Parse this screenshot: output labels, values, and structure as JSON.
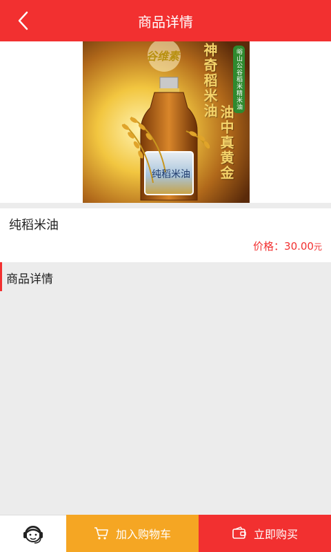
{
  "header": {
    "title": "商品详情",
    "back_icon": "chevron-left-icon"
  },
  "hero_image": {
    "brand": "谷维素",
    "side_text_1": "神奇稻米油",
    "side_text_2": "油中真黄金",
    "tag": "峪山公谷稻米精米油",
    "bottle_label": "纯稻米油"
  },
  "product": {
    "name": "纯稻米油",
    "price_label": "价格：",
    "price_value": "30.00",
    "price_unit": "元"
  },
  "details": {
    "title": "商品详情"
  },
  "footer": {
    "service_icon": "customer-service-icon",
    "add_to_cart": "加入购物车",
    "buy_now": "立即购买"
  },
  "colors": {
    "brand_red": "#f23030",
    "cart_orange": "#f5a623",
    "page_bg": "#ececec"
  }
}
